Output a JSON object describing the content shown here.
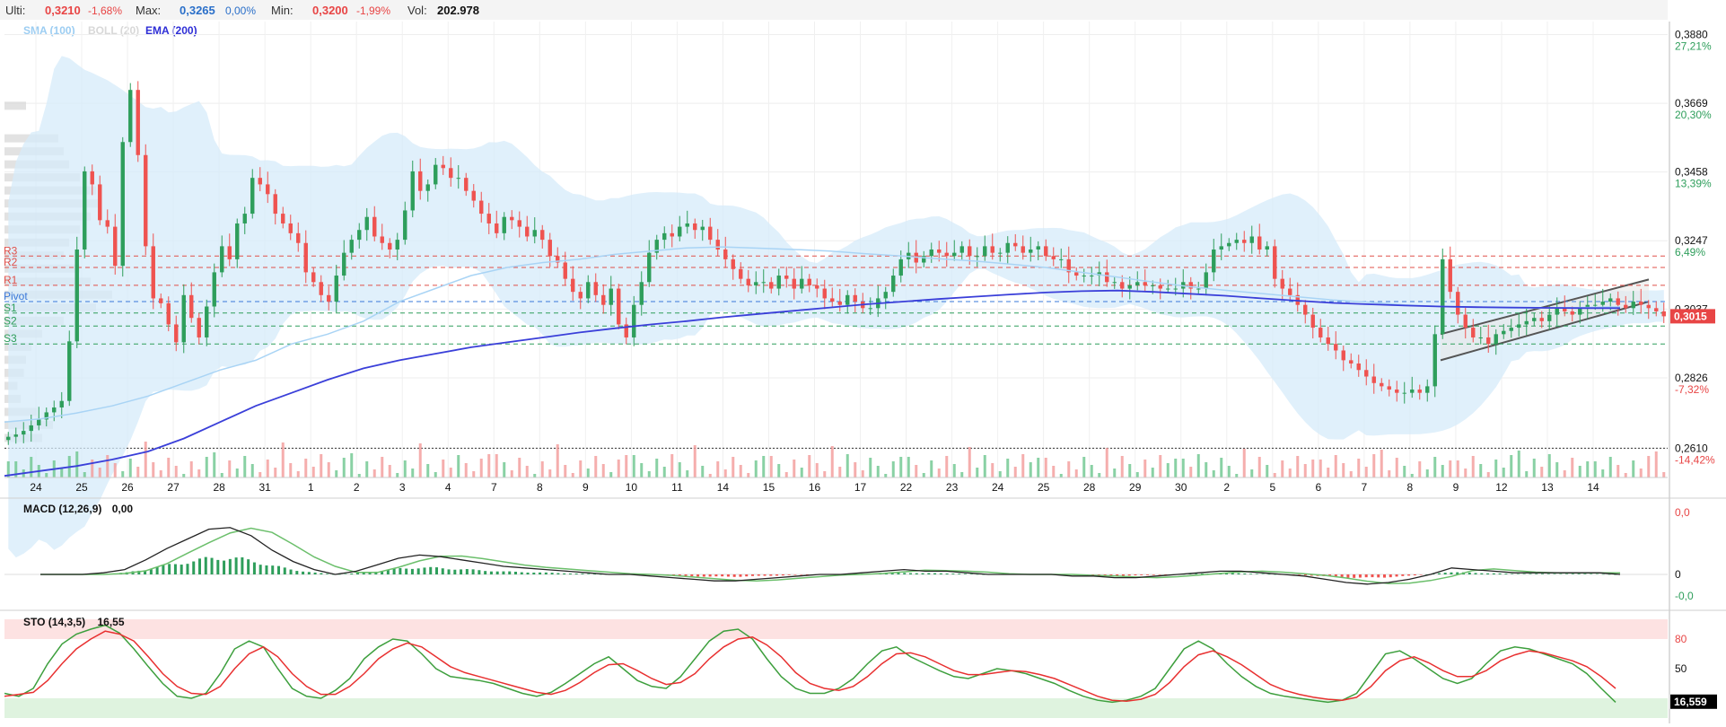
{
  "header": {
    "last_label": "Ulti:",
    "last_value": "0,3210",
    "last_change": "-1,68%",
    "max_label": "Max:",
    "max_value": "0,3265",
    "max_change": "0,00%",
    "min_label": "Min:",
    "min_value": "0,3200",
    "min_change": "-1,99%",
    "vol_label": "Vol:",
    "vol_value": "202.978"
  },
  "legend": {
    "sma": "SMA (100)",
    "boll": "BOLL (20)",
    "ema": "EMA (200)"
  },
  "colors": {
    "up": "#2e9e5b",
    "down": "#ef5350",
    "sma": "#a9d4f5",
    "boll_fill": "#d6ebfa",
    "ema": "#3a3fd9",
    "resistance": "#e0504a",
    "support": "#2e9e5b",
    "pivot": "#3a78d9",
    "price_tag": "#e84545",
    "green_pct": "#2e9e5b",
    "red_pct": "#e84545",
    "macd_line": "#222222",
    "signal_line": "#6bbf6b",
    "sto_k": "#3d9f3d",
    "sto_d": "#e83030"
  },
  "levels": [
    {
      "name": "R3",
      "value": 0.32,
      "kind": "resistance"
    },
    {
      "name": "R2",
      "value": 0.3165,
      "kind": "resistance"
    },
    {
      "name": "R1",
      "value": 0.311,
      "kind": "resistance"
    },
    {
      "name": "Pivot",
      "value": 0.306,
      "kind": "pivot"
    },
    {
      "name": "S1",
      "value": 0.3025,
      "kind": "support"
    },
    {
      "name": "S2",
      "value": 0.2985,
      "kind": "support"
    },
    {
      "name": "S3",
      "value": 0.293,
      "kind": "support"
    }
  ],
  "price_axis": [
    {
      "value": 0.388,
      "label": "0,3880",
      "pct": "27,21%",
      "sign": "up"
    },
    {
      "value": 0.3669,
      "label": "0,3669",
      "pct": "20,30%",
      "sign": "up"
    },
    {
      "value": 0.3458,
      "label": "0,3458",
      "pct": "13,39%",
      "sign": "up"
    },
    {
      "value": 0.3247,
      "label": "0,3247",
      "pct": "6,49%",
      "sign": "up"
    },
    {
      "value": 0.3037,
      "label": "0,3037",
      "pct": "",
      "sign": "up"
    },
    {
      "value": 0.2826,
      "label": "0,2826",
      "pct": "-7,32%",
      "sign": "down"
    },
    {
      "value": 0.261,
      "label": "0,2610",
      "pct": "-14,42%",
      "sign": "down"
    }
  ],
  "current_price": {
    "value": 0.3015,
    "label": "0,3015"
  },
  "dates": [
    "24",
    "25",
    "26",
    "27",
    "28",
    "31",
    "1",
    "2",
    "3",
    "4",
    "7",
    "8",
    "9",
    "10",
    "11",
    "14",
    "15",
    "16",
    "17",
    "22",
    "23",
    "24",
    "25",
    "28",
    "29",
    "30",
    "2",
    "5",
    "6",
    "7",
    "8",
    "9",
    "12",
    "13",
    "14"
  ],
  "macd": {
    "label": "MACD (12,26,9)",
    "value": "0,00",
    "axis_top": "0,0",
    "axis_zero": "0",
    "axis_bottom": "-0,0"
  },
  "sto": {
    "label": "STO (14,3,5)",
    "value": "16,55",
    "axis_80": "80",
    "axis_50": "50",
    "current": "16,559"
  },
  "chart_data": {
    "type": "candlestick",
    "title": "",
    "ylim": [
      0.252,
      0.392
    ],
    "closes": [
      0.2645,
      0.2652,
      0.2663,
      0.268,
      0.2698,
      0.272,
      0.2735,
      0.2755,
      0.2938,
      0.322,
      0.346,
      0.342,
      0.331,
      0.329,
      0.317,
      0.355,
      0.371,
      0.351,
      0.323,
      0.307,
      0.3055,
      0.299,
      0.2935,
      0.308,
      0.301,
      0.295,
      0.3045,
      0.315,
      0.323,
      0.319,
      0.33,
      0.333,
      0.344,
      0.342,
      0.339,
      0.333,
      0.33,
      0.327,
      0.324,
      0.315,
      0.312,
      0.308,
      0.306,
      0.314,
      0.321,
      0.325,
      0.328,
      0.332,
      0.326,
      0.324,
      0.322,
      0.325,
      0.334,
      0.346,
      0.34,
      0.342,
      0.348,
      0.347,
      0.344,
      0.344,
      0.34,
      0.337,
      0.333,
      0.33,
      0.327,
      0.332,
      0.331,
      0.329,
      0.326,
      0.328,
      0.325,
      0.32,
      0.318,
      0.313,
      0.309,
      0.307,
      0.312,
      0.308,
      0.305,
      0.31,
      0.299,
      0.295,
      0.305,
      0.312,
      0.321,
      0.325,
      0.327,
      0.326,
      0.329,
      0.33,
      0.328,
      0.329,
      0.325,
      0.322,
      0.319,
      0.316,
      0.313,
      0.311,
      0.312,
      0.312,
      0.31,
      0.314,
      0.313,
      0.31,
      0.313,
      0.311,
      0.31,
      0.307,
      0.306,
      0.305,
      0.308,
      0.306,
      0.304,
      0.304,
      0.307,
      0.309,
      0.314,
      0.319,
      0.321,
      0.318,
      0.32,
      0.322,
      0.321,
      0.32,
      0.321,
      0.323,
      0.32,
      0.32,
      0.323,
      0.321,
      0.321,
      0.324,
      0.323,
      0.321,
      0.322,
      0.323,
      0.32,
      0.319,
      0.319,
      0.315,
      0.314,
      0.314,
      0.314,
      0.315,
      0.312,
      0.312,
      0.31,
      0.311,
      0.312,
      0.311,
      0.311,
      0.31,
      0.31,
      0.31,
      0.312,
      0.31,
      0.31,
      0.315,
      0.322,
      0.323,
      0.324,
      0.325,
      0.324,
      0.326,
      0.322,
      0.323,
      0.313,
      0.31,
      0.308,
      0.305,
      0.302,
      0.298,
      0.295,
      0.293,
      0.291,
      0.288,
      0.287,
      0.285,
      0.283,
      0.281,
      0.28,
      0.279,
      0.278,
      0.278,
      0.279,
      0.278,
      0.28,
      0.296,
      0.319,
      0.309,
      0.302,
      0.298,
      0.295,
      0.295,
      0.293,
      0.296,
      0.297,
      0.298,
      0.299,
      0.3,
      0.301,
      0.3,
      0.302,
      0.304,
      0.303,
      0.302,
      0.304,
      0.305,
      0.305,
      0.306,
      0.307,
      0.305,
      0.304,
      0.306,
      0.305,
      0.304,
      0.303,
      0.3015
    ],
    "sma100": [
      [
        0,
        0.269
      ],
      [
        40,
        0.27
      ],
      [
        80,
        0.2718
      ],
      [
        120,
        0.274
      ],
      [
        160,
        0.277
      ],
      [
        200,
        0.281
      ],
      [
        240,
        0.285
      ],
      [
        280,
        0.288
      ],
      [
        320,
        0.293
      ],
      [
        360,
        0.296
      ],
      [
        400,
        0.3
      ],
      [
        440,
        0.306
      ],
      [
        480,
        0.31
      ],
      [
        520,
        0.314
      ],
      [
        560,
        0.3165
      ],
      [
        600,
        0.318
      ],
      [
        640,
        0.319
      ],
      [
        680,
        0.3205
      ],
      [
        720,
        0.3215
      ],
      [
        760,
        0.3225
      ],
      [
        800,
        0.3228
      ],
      [
        840,
        0.3224
      ],
      [
        880,
        0.322
      ],
      [
        920,
        0.3215
      ],
      [
        960,
        0.3207
      ],
      [
        1000,
        0.32
      ],
      [
        1040,
        0.3192
      ],
      [
        1080,
        0.3185
      ],
      [
        1120,
        0.3175
      ],
      [
        1160,
        0.3165
      ],
      [
        1200,
        0.315
      ],
      [
        1240,
        0.3135
      ],
      [
        1280,
        0.312
      ],
      [
        1320,
        0.3106
      ],
      [
        1360,
        0.3095
      ],
      [
        1400,
        0.3085
      ],
      [
        1440,
        0.3075
      ],
      [
        1480,
        0.3065
      ],
      [
        1520,
        0.3058
      ],
      [
        1560,
        0.305
      ],
      [
        1600,
        0.3045
      ],
      [
        1640,
        0.3042
      ],
      [
        1680,
        0.304
      ],
      [
        1720,
        0.304
      ],
      [
        1760,
        0.3042
      ],
      [
        1800,
        0.3044
      ]
    ],
    "ema200": [
      [
        0,
        0.2525
      ],
      [
        40,
        0.254
      ],
      [
        80,
        0.2555
      ],
      [
        120,
        0.2575
      ],
      [
        160,
        0.26
      ],
      [
        200,
        0.264
      ],
      [
        240,
        0.269
      ],
      [
        280,
        0.274
      ],
      [
        320,
        0.278
      ],
      [
        360,
        0.282
      ],
      [
        400,
        0.2855
      ],
      [
        440,
        0.288
      ],
      [
        480,
        0.29
      ],
      [
        520,
        0.292
      ],
      [
        560,
        0.2935
      ],
      [
        600,
        0.295
      ],
      [
        640,
        0.2965
      ],
      [
        680,
        0.2978
      ],
      [
        720,
        0.299
      ],
      [
        760,
        0.3
      ],
      [
        800,
        0.3012
      ],
      [
        840,
        0.3022
      ],
      [
        880,
        0.3032
      ],
      [
        920,
        0.3042
      ],
      [
        960,
        0.3052
      ],
      [
        1000,
        0.306
      ],
      [
        1040,
        0.3068
      ],
      [
        1080,
        0.3075
      ],
      [
        1120,
        0.3082
      ],
      [
        1160,
        0.3088
      ],
      [
        1200,
        0.3092
      ],
      [
        1240,
        0.3094
      ],
      [
        1280,
        0.309
      ],
      [
        1320,
        0.3084
      ],
      [
        1360,
        0.3078
      ],
      [
        1400,
        0.307
      ],
      [
        1440,
        0.3063
      ],
      [
        1480,
        0.3056
      ],
      [
        1520,
        0.3052
      ],
      [
        1560,
        0.3048
      ],
      [
        1600,
        0.3045
      ],
      [
        1640,
        0.3043
      ],
      [
        1680,
        0.3042
      ],
      [
        1720,
        0.3041
      ],
      [
        1760,
        0.304
      ],
      [
        1800,
        0.304
      ]
    ],
    "macd_points": [
      0,
      0,
      0,
      0.1,
      0.3,
      0.9,
      1.6,
      2.2,
      2.8,
      2.9,
      2.4,
      1.5,
      0.8,
      0.3,
      0.0,
      0.2,
      0.6,
      1.0,
      1.2,
      1.1,
      0.9,
      0.7,
      0.5,
      0.4,
      0.3,
      0.2,
      0.1,
      0.0,
      0.0,
      -0.1,
      -0.2,
      -0.3,
      -0.4,
      -0.4,
      -0.3,
      -0.2,
      -0.1,
      0.0,
      0.0,
      0.1,
      0.2,
      0.3,
      0.2,
      0.2,
      0.1,
      0.0,
      0.0,
      0.0,
      0.0,
      -0.1,
      -0.1,
      -0.2,
      -0.2,
      -0.1,
      0.0,
      0.1,
      0.2,
      0.2,
      0.1,
      0.0,
      -0.1,
      -0.3,
      -0.5,
      -0.6,
      -0.5,
      -0.3,
      0.0,
      0.4,
      0.3,
      0.2,
      0.1,
      0.1,
      0.1,
      0.1,
      0.1,
      0.0
    ],
    "sto_k": [
      25,
      22,
      30,
      55,
      75,
      85,
      90,
      94,
      86,
      70,
      52,
      35,
      22,
      20,
      25,
      45,
      70,
      78,
      72,
      50,
      30,
      22,
      20,
      28,
      40,
      60,
      72,
      80,
      78,
      65,
      50,
      42,
      40,
      38,
      35,
      30,
      25,
      22,
      26,
      35,
      45,
      55,
      62,
      50,
      38,
      32,
      30,
      42,
      60,
      78,
      88,
      90,
      80,
      60,
      42,
      30,
      25,
      25,
      30,
      40,
      55,
      68,
      72,
      62,
      55,
      48,
      42,
      40,
      45,
      50,
      48,
      45,
      40,
      35,
      28,
      22,
      18,
      16,
      18,
      22,
      30,
      50,
      70,
      78,
      70,
      55,
      42,
      32,
      25,
      22,
      20,
      18,
      16,
      18,
      25,
      45,
      65,
      68,
      60,
      50,
      40,
      35,
      40,
      55,
      68,
      72,
      70,
      65,
      60,
      55,
      45,
      30,
      16
    ],
    "sto_d": [
      22,
      24,
      26,
      38,
      55,
      70,
      80,
      88,
      85,
      78,
      62,
      45,
      32,
      25,
      24,
      32,
      50,
      65,
      72,
      62,
      45,
      32,
      24,
      24,
      32,
      45,
      60,
      70,
      76,
      72,
      62,
      52,
      46,
      42,
      38,
      34,
      30,
      26,
      24,
      28,
      36,
      46,
      54,
      55,
      48,
      40,
      34,
      36,
      45,
      60,
      72,
      80,
      82,
      74,
      62,
      46,
      35,
      30,
      28,
      32,
      42,
      55,
      65,
      66,
      62,
      55,
      48,
      44,
      44,
      46,
      48,
      47,
      44,
      40,
      34,
      28,
      22,
      18,
      17,
      19,
      24,
      36,
      52,
      64,
      68,
      62,
      54,
      44,
      34,
      28,
      24,
      21,
      19,
      18,
      21,
      32,
      48,
      58,
      62,
      56,
      48,
      42,
      42,
      48,
      58,
      64,
      68,
      66,
      62,
      58,
      52,
      42,
      30
    ]
  }
}
